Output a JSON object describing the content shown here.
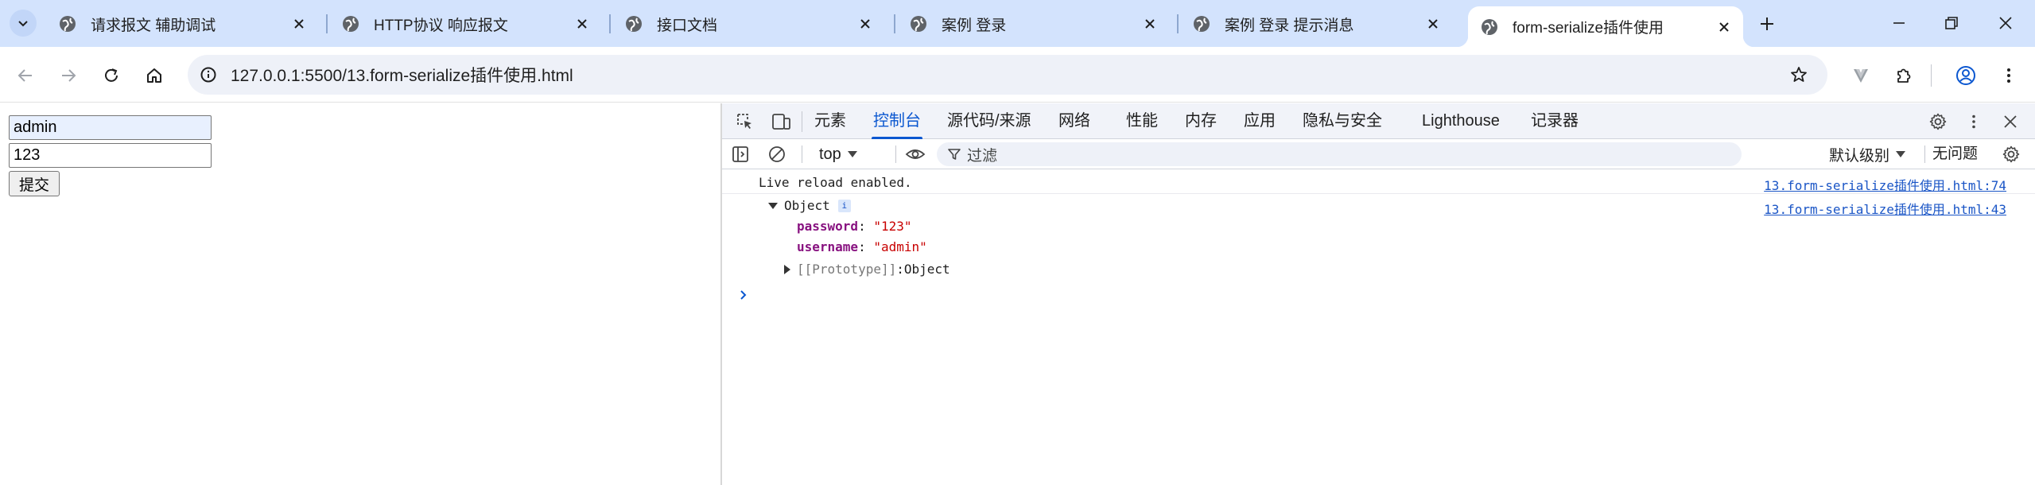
{
  "tabs": [
    {
      "title": "请求报文 辅助调试",
      "active": false
    },
    {
      "title": "HTTP协议 响应报文",
      "active": false
    },
    {
      "title": "接口文档",
      "active": false
    },
    {
      "title": "案例 登录",
      "active": false
    },
    {
      "title": "案例 登录 提示消息",
      "active": false
    },
    {
      "title": "form-serialize插件使用",
      "active": true
    }
  ],
  "toolbar": {
    "url": "127.0.0.1:5500/13.form-serialize插件使用.html"
  },
  "page": {
    "username_value": "admin",
    "password_value": "123",
    "submit_label": "提交"
  },
  "devtools": {
    "tabs": [
      "元素",
      "控制台",
      "源代码/来源",
      "网络",
      "性能",
      "内存",
      "应用",
      "隐私与安全",
      "Lighthouse",
      "记录器"
    ],
    "active_tab": "控制台",
    "context": "top",
    "filter_placeholder": "过滤",
    "levels": "默认级别",
    "issues": "无问题"
  },
  "console": {
    "msg1_text": "Live reload enabled.",
    "msg1_source": "13.form-serialize插件使用.html:74",
    "msg2_source": "13.form-serialize插件使用.html:43",
    "object_label": "Object",
    "info_badge": "i",
    "props": [
      {
        "key": "password",
        "value": "\"123\""
      },
      {
        "key": "username",
        "value": "\"admin\""
      }
    ],
    "proto_key": "[[Prototype]]",
    "proto_value": "Object"
  },
  "colors": {
    "tabstrip_bg": "#d3e3fd",
    "accent": "#0b57d0",
    "link": "#1a55c6",
    "prop_key": "#881280",
    "string_value": "#c80000"
  }
}
